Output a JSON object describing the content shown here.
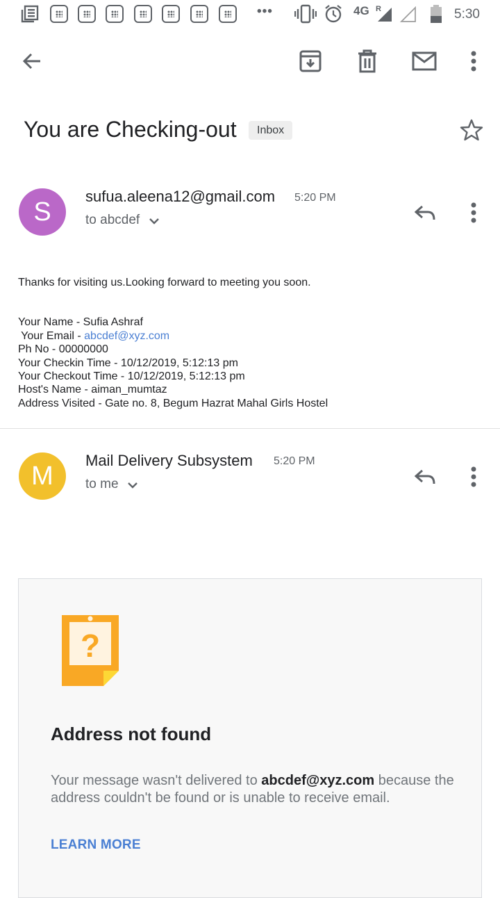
{
  "status_bar": {
    "dots": "•••",
    "network": "4G",
    "roaming": "R",
    "time": "5:30"
  },
  "toolbar": {
    "back_icon": "arrow-back-icon",
    "archive_icon": "archive-icon",
    "delete_icon": "trash-icon",
    "mark_unread_icon": "mail-icon",
    "more_icon": "more-vert-icon"
  },
  "subject": {
    "title": "You are Checking-out",
    "label": "Inbox"
  },
  "messages": [
    {
      "avatar_letter": "S",
      "avatar_color": "#ba68c8",
      "sender": "sufua.aleena12@gmail.com",
      "time": "5:20 PM",
      "recipient": "to abcdef",
      "body": {
        "greeting": "Thanks for visiting us.Looking forward to meeting you soon.",
        "name_line": "Your Name - Sufia Ashraf",
        "email_prefix": " Your Email - ",
        "email_link": "abcdef@xyz.com",
        "phone_line": "Ph No - 00000000",
        "checkin_line": "Your Checkin Time - 10/12/2019, 5:12:13 pm",
        "checkout_line": "Your Checkout Time - 10/12/2019, 5:12:13 pm",
        "host_line": "Host's Name - aiman_mumtaz",
        "address_line": "Address Visited - Gate no. 8, Begum Hazrat Mahal Girls Hostel"
      }
    },
    {
      "avatar_letter": "M",
      "avatar_color": "#f2c02c",
      "sender": "Mail Delivery Subsystem",
      "time": "5:20 PM",
      "recipient": "to me"
    }
  ],
  "bounce": {
    "icon": "question-note-icon",
    "title": "Address not found",
    "msg_before": "Your message wasn't delivered to ",
    "msg_address": "abcdef@xyz.com",
    "msg_after": " because the address couldn't be found or is unable to receive email.",
    "learn_more": "LEARN MORE"
  },
  "colors": {
    "link": "#4a7fd3",
    "icon_gray": "#5f6368",
    "note_orange": "#f9a825"
  }
}
